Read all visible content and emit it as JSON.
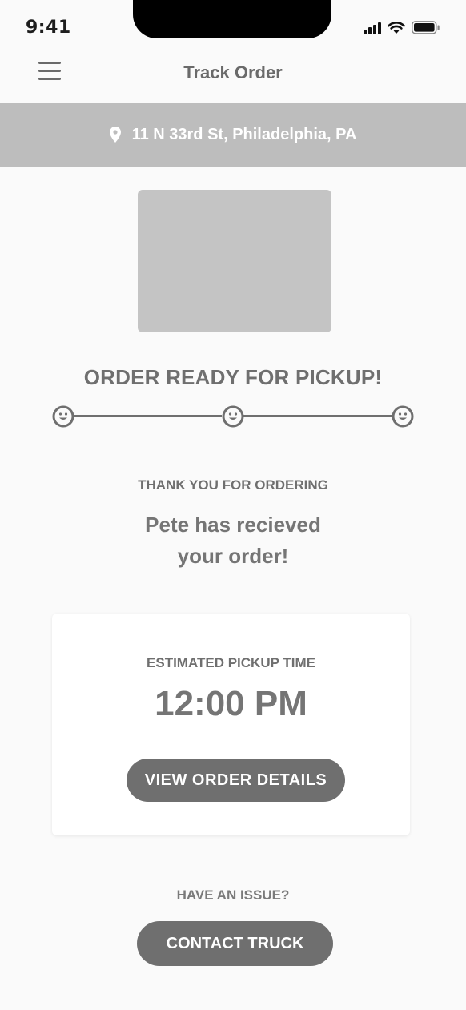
{
  "status_bar": {
    "time": "9:41",
    "icons": [
      "signal-icon",
      "wifi-icon",
      "battery-icon"
    ]
  },
  "header": {
    "title": "Track Order",
    "menu_icon": "hamburger-menu-icon"
  },
  "address": {
    "icon": "location-pin-icon",
    "text": "11 N 33rd St, Philadelphia, PA"
  },
  "order": {
    "status_heading": "ORDER READY FOR PICKUP!",
    "progress_steps": 3,
    "progress_icon": "smiley-face-icon",
    "thank_label": "THANK YOU FOR ORDERING",
    "received_line1": "Pete has recieved",
    "received_line2": "your order!"
  },
  "pickup_card": {
    "label": "ESTIMATED PICKUP TIME",
    "time": "12:00 PM",
    "button_label": "VIEW ORDER DETAILS"
  },
  "support": {
    "issue_label": "HAVE AN ISSUE?",
    "contact_button_label": "CONTACT TRUCK"
  },
  "colors": {
    "background": "#fafafa",
    "address_bar": "#bdbdbd",
    "placeholder": "#c4c4c4",
    "primary_gray": "#6f6f6f",
    "card": "#ffffff"
  }
}
